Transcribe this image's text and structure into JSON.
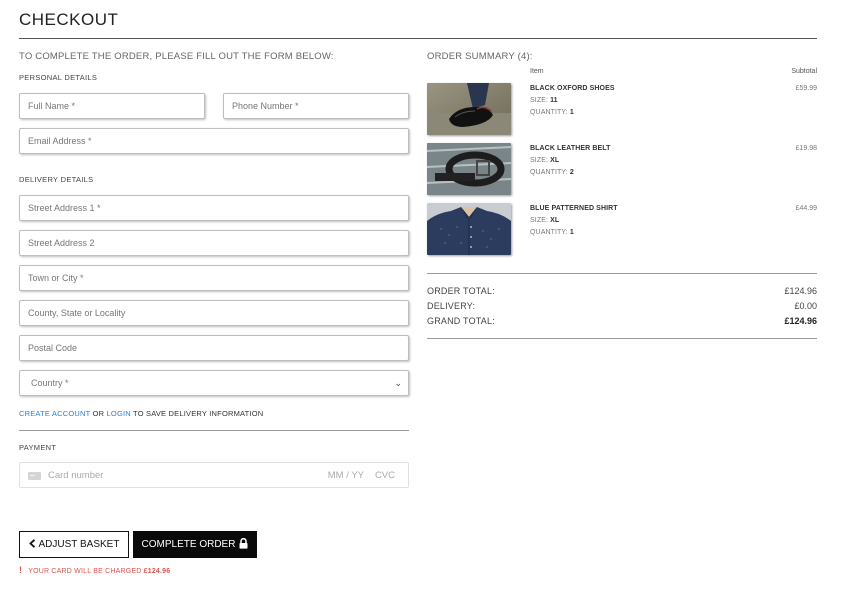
{
  "page": {
    "title": "CHECKOUT"
  },
  "form": {
    "heading": "TO COMPLETE THE ORDER, PLEASE FILL OUT THE FORM BELOW:",
    "personal_heading": "PERSONAL DETAILS",
    "full_name_placeholder": "Full Name *",
    "phone_placeholder": "Phone Number *",
    "email_placeholder": "Email Address *",
    "delivery_heading": "DELIVERY DETAILS",
    "street1_placeholder": "Street Address 1 *",
    "street2_placeholder": "Street Address 2",
    "town_placeholder": "Town or City *",
    "county_placeholder": "County, State or Locality",
    "postal_placeholder": "Postal Code",
    "country_selected": "Country *",
    "create_account_link": "CREATE ACCOUNT",
    "or_text": "OR",
    "login_link": "LOGIN",
    "save_info_text": "TO SAVE DELIVERY INFORMATION",
    "payment_heading": "PAYMENT",
    "card_number_placeholder": "Card number",
    "card_expiry_placeholder": "MM / YY",
    "card_cvc_placeholder": "CVC"
  },
  "summary": {
    "heading": "ORDER SUMMARY (4):",
    "col_item": "Item",
    "col_subtotal": "Subtotal",
    "size_label": "SIZE:",
    "quantity_label": "QUANTITY:",
    "items": [
      {
        "name": "BLACK OXFORD SHOES",
        "size": "11",
        "quantity": "1",
        "price": "£59.99",
        "image": "black-oxford-shoes-photo"
      },
      {
        "name": "BLACK LEATHER BELT",
        "size": "XL",
        "quantity": "2",
        "price": "£19.98",
        "image": "black-leather-belt-photo"
      },
      {
        "name": "BLUE PATTERNED SHIRT",
        "size": "XL",
        "quantity": "1",
        "price": "£44.99",
        "image": "blue-patterned-shirt-photo"
      }
    ],
    "order_total_label": "ORDER TOTAL:",
    "order_total": "£124.96",
    "delivery_label": "DELIVERY:",
    "delivery": "£0.00",
    "grand_total_label": "GRAND TOTAL:",
    "grand_total": "£124.96"
  },
  "actions": {
    "adjust_basket": "ADJUST BASKET",
    "complete_order": "COMPLETE ORDER",
    "charge_warning": "YOUR CARD WILL BE CHARGED",
    "charge_amount": "£124.96"
  },
  "colors": {
    "link": "#2a7fd4",
    "warning": "#d9534f",
    "primary_button": "#0a0a0a"
  }
}
